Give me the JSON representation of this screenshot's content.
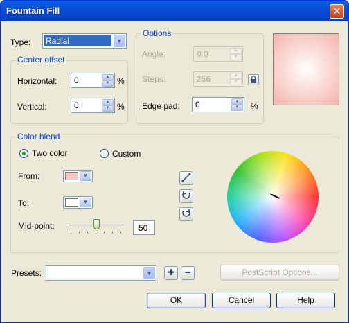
{
  "window": {
    "title": "Fountain Fill"
  },
  "type_field": {
    "label": "Type:",
    "value": "Radial"
  },
  "center_offset": {
    "title": "Center offset",
    "horizontal_label": "Horizontal:",
    "horizontal_value": "0",
    "horizontal_unit": "%",
    "vertical_label": "Vertical:",
    "vertical_value": "0",
    "vertical_unit": "%"
  },
  "options": {
    "title": "Options",
    "angle_label": "Angle:",
    "angle_value": "0.0",
    "steps_label": "Steps:",
    "steps_value": "256",
    "edge_pad_label": "Edge pad:",
    "edge_pad_value": "0",
    "edge_pad_unit": "%"
  },
  "color_blend": {
    "title": "Color blend",
    "two_color_label": "Two color",
    "custom_label": "Custom",
    "selected": "Two color",
    "from_label": "From:",
    "from_color": "#f8c8c0",
    "to_label": "To:",
    "to_color": "#ffffff",
    "midpoint_label": "Mid-point:",
    "midpoint_value": "50"
  },
  "presets": {
    "label": "Presets:",
    "value": "",
    "postscript_label": "PostScript Options..."
  },
  "buttons": {
    "ok": "OK",
    "cancel": "Cancel",
    "help": "Help"
  },
  "preview": {
    "center_color": "#ffffff",
    "edge_color": "#f4b3ab"
  }
}
